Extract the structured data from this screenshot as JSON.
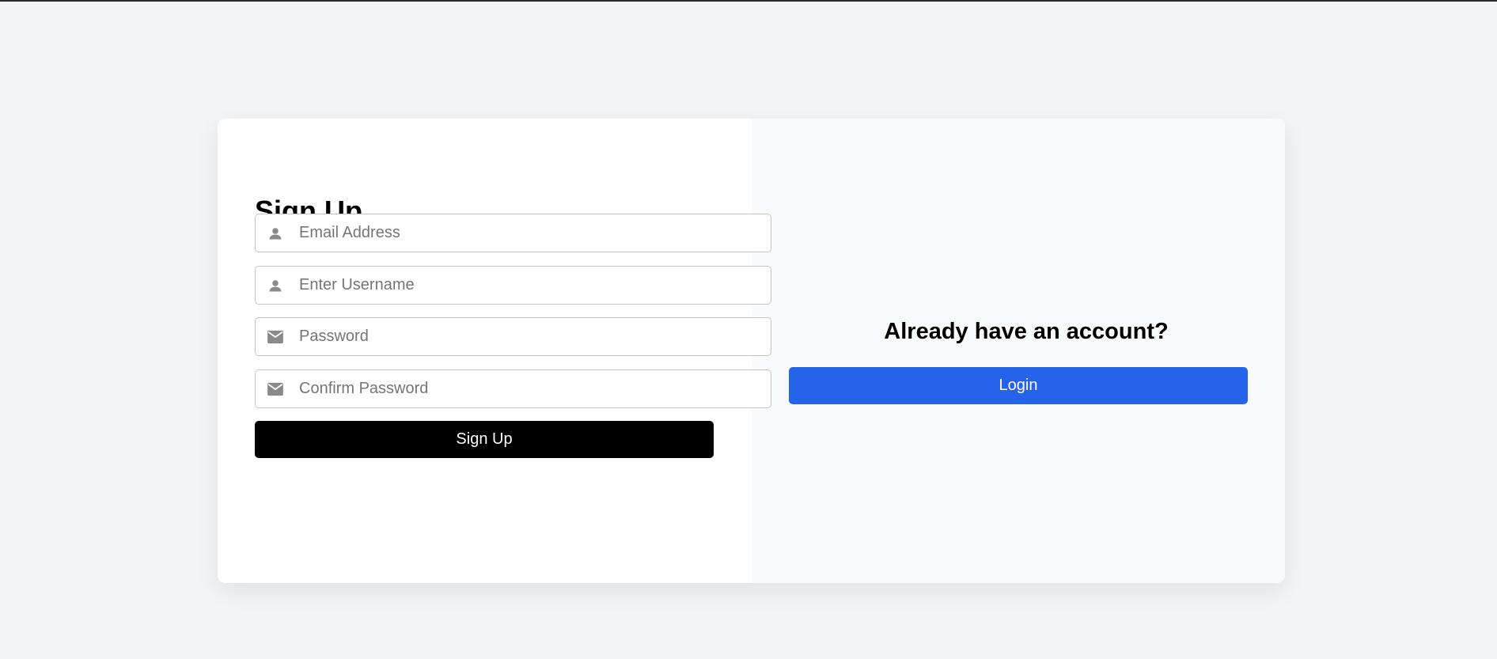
{
  "signup": {
    "title": "Sign Up",
    "fields": [
      {
        "placeholder": "Email Address",
        "value": "",
        "icon": "user-icon"
      },
      {
        "placeholder": "Enter Username",
        "value": "",
        "icon": "user-icon"
      },
      {
        "placeholder": "Password",
        "value": "",
        "icon": "mail-icon"
      },
      {
        "placeholder": "Confirm Password",
        "value": "",
        "icon": "mail-icon"
      }
    ],
    "submit_label": "Sign Up"
  },
  "login": {
    "prompt": "Already have an account?",
    "button_label": "Login"
  },
  "colors": {
    "page_background": "#f3f4f6",
    "card_left": "#ffffff",
    "card_right": "#f9fafb",
    "signup_button": "#000000",
    "login_button": "#2563eb",
    "icon": "#8a8a8a"
  }
}
